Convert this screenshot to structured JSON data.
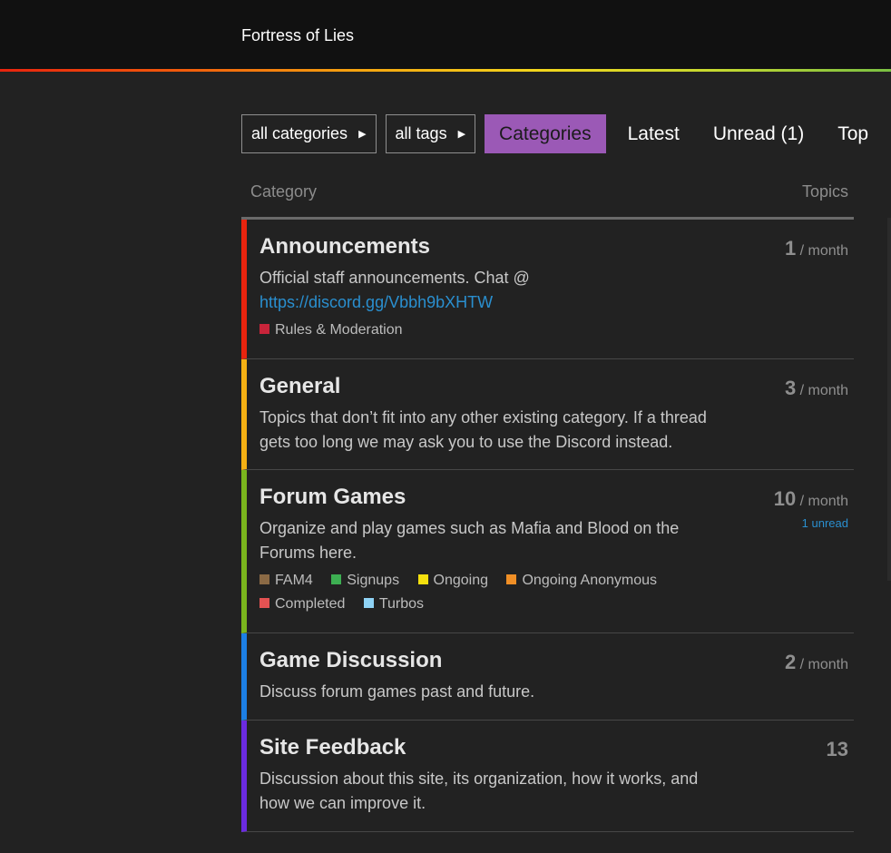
{
  "site": {
    "title": "Fortress of Lies"
  },
  "nav": {
    "categories_dropdown": "all categories",
    "tags_dropdown": "all tags",
    "tabs": [
      "Categories",
      "Latest",
      "Unread (1)",
      "Top"
    ]
  },
  "table": {
    "col_category": "Category",
    "col_topics": "Topics"
  },
  "categories": [
    {
      "name": "Announcements",
      "color": "#e8240e",
      "desc": "Official staff announcements. Chat @ ",
      "link": "https://discord.gg/Vbbh9bXHTW",
      "count": "1",
      "per": "/ month",
      "subcats": [
        {
          "name": "Rules & Moderation",
          "color": "#c8243a"
        }
      ]
    },
    {
      "name": "General",
      "color": "#f5b114",
      "desc": "Topics that don’t fit into any other existing category. If a thread gets too long we may ask you to use the Discord instead.",
      "count": "3",
      "per": "/ month"
    },
    {
      "name": "Forum Games",
      "color": "#7ab51d",
      "desc": "Organize and play games such as Mafia and Blood on the Forums here.",
      "count": "10",
      "per": "/ month",
      "unread": "1 unread",
      "subcats": [
        {
          "name": "FAM4",
          "color": "#8b6a45"
        },
        {
          "name": "Signups",
          "color": "#3daf52"
        },
        {
          "name": "Ongoing",
          "color": "#f5e00e"
        },
        {
          "name": "Ongoing Anonymous",
          "color": "#f08f26"
        },
        {
          "name": "Completed",
          "color": "#e45252"
        },
        {
          "name": "Turbos",
          "color": "#8fd3f5"
        }
      ]
    },
    {
      "name": "Game Discussion",
      "color": "#1c7fe5",
      "desc": "Discuss forum games past and future.",
      "count": "2",
      "per": "/ month"
    },
    {
      "name": "Site Feedback",
      "color": "#6b2be0",
      "desc": "Discussion about this site, its organization, how it works, and how we can improve it.",
      "count": "13"
    }
  ]
}
